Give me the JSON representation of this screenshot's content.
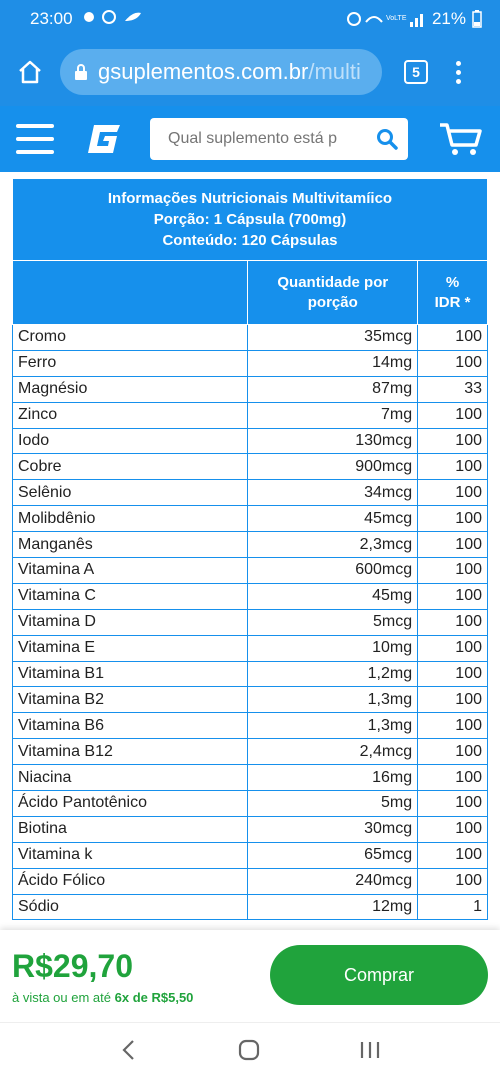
{
  "status": {
    "time": "23:00",
    "battery": "21%"
  },
  "browser": {
    "url_host": "gsuplementos.com.br",
    "url_path": "/multi",
    "tab_count": "5"
  },
  "header": {
    "search_placeholder": "Qual suplemento está p"
  },
  "table": {
    "title_lines": [
      "Informações Nutricionais Multivitamíico",
      "Porção: 1 Cápsula (700mg)",
      "Conteúdo: 120 Cápsulas"
    ],
    "col_qty_line1": "Quantidade por",
    "col_qty_line2": "porção",
    "col_idr_line1": "%",
    "col_idr_line2": "IDR *",
    "rows": [
      {
        "name": "Cromo",
        "qty": "35mcg",
        "idr": "100"
      },
      {
        "name": "Ferro",
        "qty": "14mg",
        "idr": "100"
      },
      {
        "name": "Magnésio",
        "qty": "87mg",
        "idr": "33"
      },
      {
        "name": "Zinco",
        "qty": "7mg",
        "idr": "100"
      },
      {
        "name": "Iodo",
        "qty": "130mcg",
        "idr": "100"
      },
      {
        "name": "Cobre",
        "qty": "900mcg",
        "idr": "100"
      },
      {
        "name": "Selênio",
        "qty": "34mcg",
        "idr": "100"
      },
      {
        "name": "Molibdênio",
        "qty": "45mcg",
        "idr": "100"
      },
      {
        "name": "Manganês",
        "qty": "2,3mcg",
        "idr": "100"
      },
      {
        "name": "Vitamina A",
        "qty": "600mcg",
        "idr": "100"
      },
      {
        "name": "Vitamina C",
        "qty": "45mg",
        "idr": "100"
      },
      {
        "name": "Vitamina D",
        "qty": "5mcg",
        "idr": "100"
      },
      {
        "name": "Vitamina E",
        "qty": "10mg",
        "idr": "100"
      },
      {
        "name": "Vitamina B1",
        "qty": "1,2mg",
        "idr": "100"
      },
      {
        "name": "Vitamina B2",
        "qty": "1,3mg",
        "idr": "100"
      },
      {
        "name": "Vitamina B6",
        "qty": "1,3mg",
        "idr": "100"
      },
      {
        "name": "Vitamina B12",
        "qty": "2,4mcg",
        "idr": "100"
      },
      {
        "name": "Niacina",
        "qty": "16mg",
        "idr": "100"
      },
      {
        "name": "Ácido Pantotênico",
        "qty": "5mg",
        "idr": "100"
      },
      {
        "name": "Biotina",
        "qty": "30mcg",
        "idr": "100"
      },
      {
        "name": "Vitamina k",
        "qty": "65mcg",
        "idr": "100"
      },
      {
        "name": "Ácido Fólico",
        "qty": "240mcg",
        "idr": "100"
      },
      {
        "name": "Sódio",
        "qty": "12mg",
        "idr": "1"
      }
    ]
  },
  "purchase": {
    "price": "R$29,70",
    "installment_prefix": "à vista ou em até",
    "installment_detail": "6x de R$5,50",
    "buy_label": "Comprar"
  },
  "colors": {
    "brand_blue": "#1690ec",
    "buy_green": "#20a33c"
  },
  "icons": [
    "home-icon",
    "lock-icon",
    "hamburger-menu-icon",
    "gsuplementos-logo",
    "search-icon",
    "cart-icon",
    "back-icon",
    "home-circle-icon",
    "recents-icon"
  ]
}
